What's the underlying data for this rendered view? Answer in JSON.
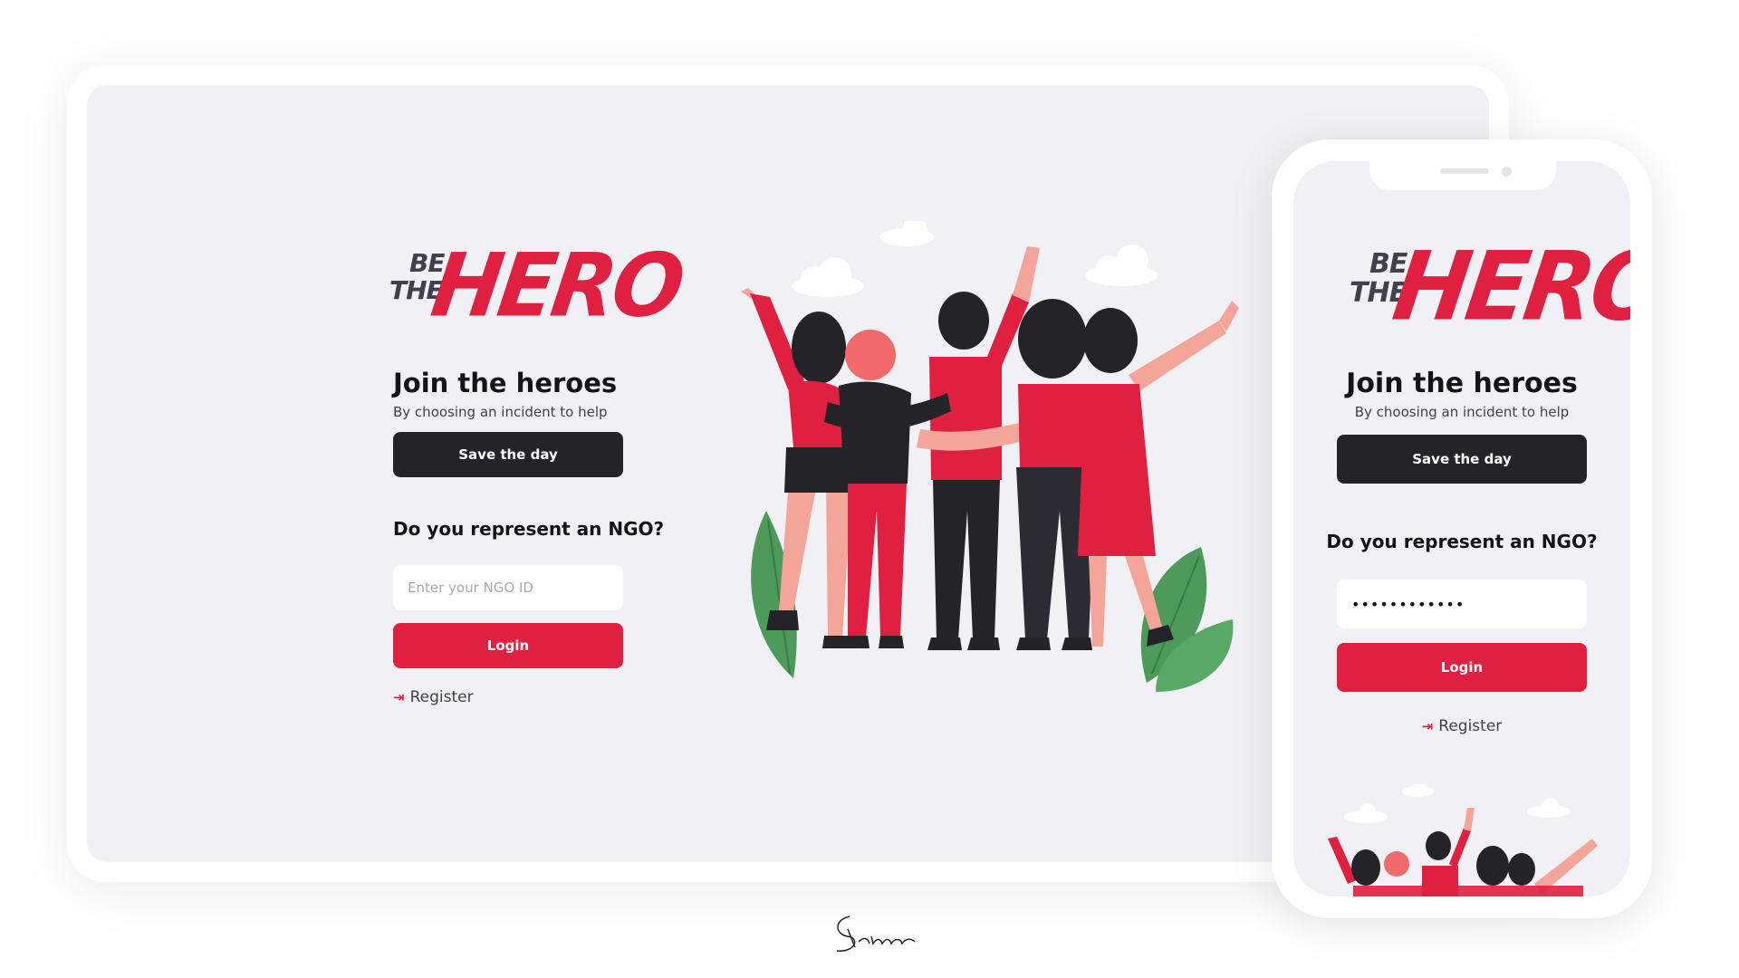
{
  "brand": {
    "be": "BE",
    "the": "THE",
    "hero": "HERO",
    "accent_color": "#e02041",
    "dark_color": "#232329"
  },
  "desktop": {
    "title": "Join the heroes",
    "subtitle": "By choosing an incident to help",
    "save_button": "Save the day",
    "ngo_question": "Do you represent an NGO?",
    "ngo_input_placeholder": "Enter your NGO ID",
    "ngo_input_value": "",
    "login_button": "Login",
    "register_link": "Register",
    "register_icon": "log-in-icon"
  },
  "mobile": {
    "title": "Join the heroes",
    "subtitle": "By choosing an incident to help",
    "save_button": "Save the day",
    "ngo_question": "Do you represent an NGO?",
    "ngo_input_value": "••••••••••••",
    "login_button": "Login",
    "register_link": "Register",
    "register_icon": "log-in-icon"
  }
}
